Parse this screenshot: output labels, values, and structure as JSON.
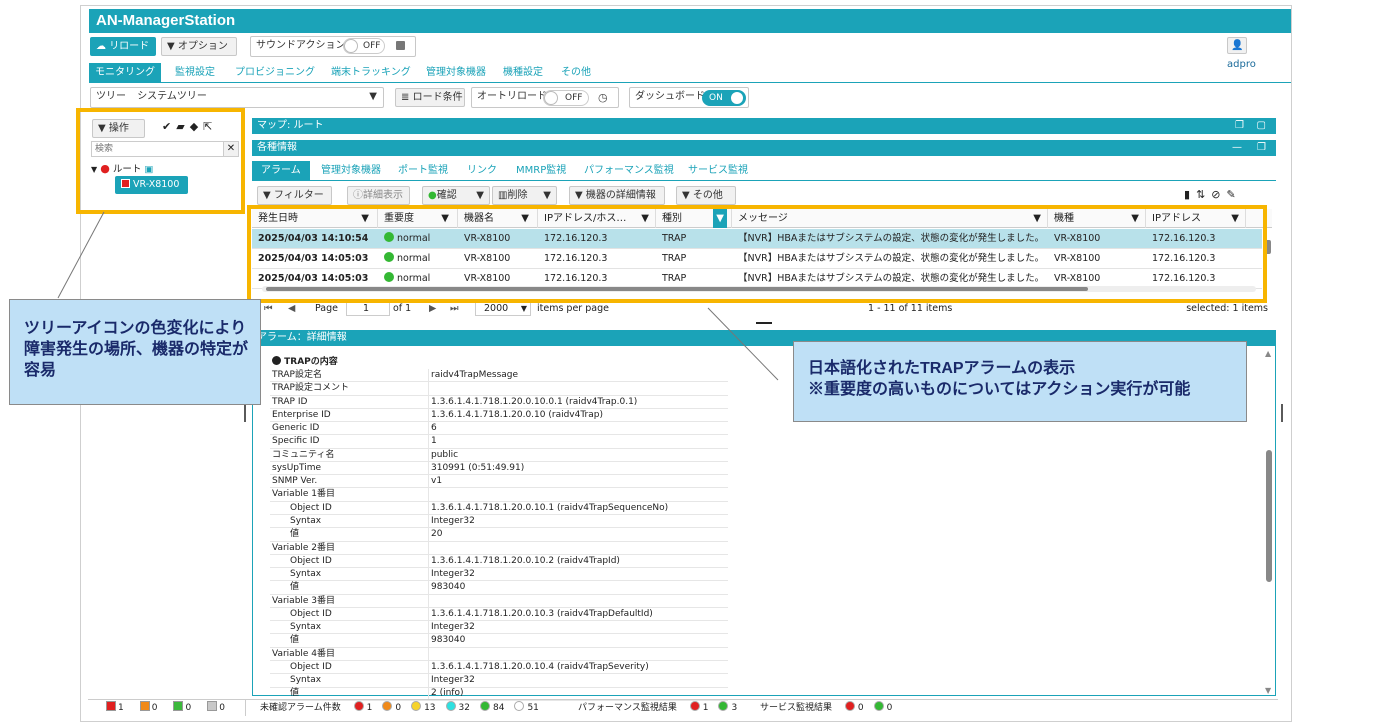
{
  "app": {
    "title": "AN-ManagerStation",
    "user": "adpro"
  },
  "toolbar": {
    "reload": "リロード",
    "options": "オプション",
    "sound_action": "サウンドアクション",
    "sound_state": "OFF"
  },
  "main_tabs": [
    "モニタリング",
    "監視設定",
    "プロビジョニング",
    "端末トラッキング",
    "管理対象機器",
    "機種設定",
    "その他"
  ],
  "tree_bar": {
    "label": "ツリー",
    "selected": "システムツリー",
    "load_condition": "ロード条件",
    "auto_reload": "オートリロード",
    "auto_reload_state": "OFF",
    "dashboard": "ダッシュボード",
    "dashboard_state": "ON"
  },
  "tree_panel": {
    "operation": "操作",
    "search_placeholder": "検索",
    "root_label": "ルート",
    "device_label": "VR-X8100"
  },
  "map_header": "マップ: ルート",
  "info_header": "各種情報",
  "info_tabs": [
    "アラーム",
    "管理対象機器",
    "ポート監視",
    "リンク",
    "MMRP監視",
    "パフォーマンス監視",
    "サービス監視"
  ],
  "actions": {
    "filter": "フィルター",
    "detail": "詳細表示",
    "confirm": "確認",
    "delete": "削除",
    "device_detail": "機器の詳細情報",
    "other": "その他"
  },
  "grid": {
    "columns": [
      "発生日時",
      "重要度",
      "機器名",
      "IPアドレス/ホス…",
      "種別",
      "メッセージ",
      "機種",
      "IPアドレス"
    ],
    "rows": [
      {
        "time": "2025/04/03 14:10:54",
        "severity": "normal",
        "device": "VR-X8100",
        "ip": "172.16.120.3",
        "type": "TRAP",
        "message": "【NVR】HBAまたはサブシステムの設定、状態の変化が発生しました。",
        "model": "VR-X8100",
        "ip2": "172.16.120.3"
      },
      {
        "time": "2025/04/03 14:05:03",
        "severity": "normal",
        "device": "VR-X8100",
        "ip": "172.16.120.3",
        "type": "TRAP",
        "message": "【NVR】HBAまたはサブシステムの設定、状態の変化が発生しました。",
        "model": "VR-X8100",
        "ip2": "172.16.120.3"
      },
      {
        "time": "2025/04/03 14:05:03",
        "severity": "normal",
        "device": "VR-X8100",
        "ip": "172.16.120.3",
        "type": "TRAP",
        "message": "【NVR】HBAまたはサブシステムの設定、状態の変化が発生しました。",
        "model": "VR-X8100",
        "ip2": "172.16.120.3"
      }
    ]
  },
  "pager": {
    "page_label": "Page",
    "page": "1",
    "of": "of 1",
    "per_page": "2000",
    "per_page_label": "items per page",
    "range": "1 - 11 of 11 items",
    "selected": "selected: 1 items"
  },
  "detail": {
    "header": "アラーム：詳細情報",
    "section": "TRAPの内容",
    "rows": [
      {
        "k": "TRAP設定名",
        "v": "raidv4TrapMessage",
        "sub": false
      },
      {
        "k": "TRAP設定コメント",
        "v": "",
        "sub": false
      },
      {
        "k": "TRAP ID",
        "v": "1.3.6.1.4.1.718.1.20.0.10.0.1 (raidv4Trap.0.1)",
        "sub": false
      },
      {
        "k": "Enterprise ID",
        "v": "1.3.6.1.4.1.718.1.20.0.10 (raidv4Trap)",
        "sub": false
      },
      {
        "k": "Generic ID",
        "v": "6",
        "sub": false
      },
      {
        "k": "Specific ID",
        "v": "1",
        "sub": false
      },
      {
        "k": "コミュニティ名",
        "v": "public",
        "sub": false
      },
      {
        "k": "sysUpTime",
        "v": "310991 (0:51:49.91)",
        "sub": false
      },
      {
        "k": "SNMP Ver.",
        "v": "v1",
        "sub": false
      },
      {
        "k": "Variable 1番目",
        "v": "",
        "sub": false
      },
      {
        "k": "Object ID",
        "v": "1.3.6.1.4.1.718.1.20.0.10.1 (raidv4TrapSequenceNo)",
        "sub": true
      },
      {
        "k": "Syntax",
        "v": "Integer32",
        "sub": true
      },
      {
        "k": "値",
        "v": "20",
        "sub": true
      },
      {
        "k": "Variable 2番目",
        "v": "",
        "sub": false
      },
      {
        "k": "Object ID",
        "v": "1.3.6.1.4.1.718.1.20.0.10.2 (raidv4TrapId)",
        "sub": true
      },
      {
        "k": "Syntax",
        "v": "Integer32",
        "sub": true
      },
      {
        "k": "値",
        "v": "983040",
        "sub": true
      },
      {
        "k": "Variable 3番目",
        "v": "",
        "sub": false
      },
      {
        "k": "Object ID",
        "v": "1.3.6.1.4.1.718.1.20.0.10.3 (raidv4TrapDefaultId)",
        "sub": true
      },
      {
        "k": "Syntax",
        "v": "Integer32",
        "sub": true
      },
      {
        "k": "値",
        "v": "983040",
        "sub": true
      },
      {
        "k": "Variable 4番目",
        "v": "",
        "sub": false
      },
      {
        "k": "Object ID",
        "v": "1.3.6.1.4.1.718.1.20.0.10.4 (raidv4TrapSeverity)",
        "sub": true
      },
      {
        "k": "Syntax",
        "v": "Integer32",
        "sub": true
      },
      {
        "k": "値",
        "v": "2 (info)",
        "sub": true
      }
    ]
  },
  "status": {
    "counts": [
      {
        "color": "#e02020",
        "value": "1"
      },
      {
        "color": "#f08a1a",
        "value": "0"
      },
      {
        "color": "#3cb83c",
        "value": "0"
      },
      {
        "color": "#c8c8c8",
        "value": "0"
      }
    ],
    "unconfirmed_label": "未確認アラーム件数",
    "unconfirmed": [
      {
        "color": "#e02020",
        "value": "1"
      },
      {
        "color": "#f08a1a",
        "value": "0"
      },
      {
        "color": "#f6d32a",
        "value": "13"
      },
      {
        "color": "#2ee0e0",
        "value": "32"
      },
      {
        "color": "#34b834",
        "value": "84"
      },
      {
        "color": "#ffffff",
        "value": "51"
      }
    ],
    "perf_label": "パフォーマンス監視結果",
    "perf": [
      {
        "color": "#e02020",
        "value": "1"
      },
      {
        "color": "#34b834",
        "value": "3"
      }
    ],
    "service_label": "サービス監視結果",
    "service": [
      {
        "color": "#e02020",
        "value": "0"
      },
      {
        "color": "#34b834",
        "value": "0"
      }
    ]
  },
  "notes": {
    "left": "ツリーアイコンの色変化により障害発生の場所、機器の特定が容易",
    "right_line1": "日本語化されたTRAPアラームの表示",
    "right_line2": "※重要度の高いものについてはアクション実行が可能"
  },
  "colors": {
    "accent": "#1ba3b8",
    "highlight": "#f7b500",
    "note_bg": "#bfe0f6"
  }
}
